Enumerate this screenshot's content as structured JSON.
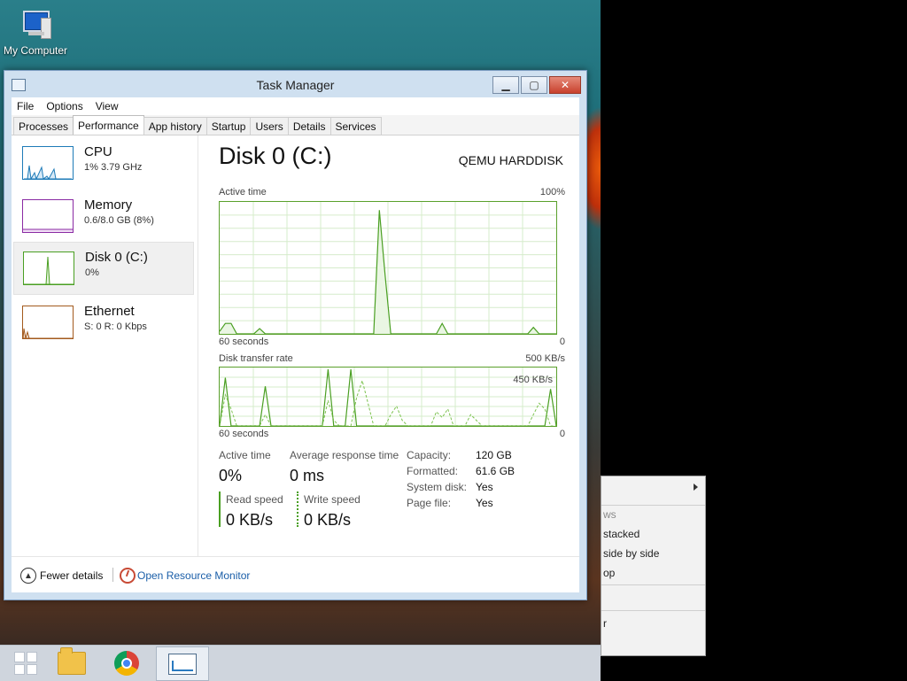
{
  "desktop": {
    "icons": [
      {
        "label": "My Computer",
        "icon": "computer-icon"
      }
    ]
  },
  "window": {
    "title": "Task Manager",
    "menu": [
      "File",
      "Options",
      "View"
    ],
    "tabs": [
      {
        "label": "Processes",
        "active": false
      },
      {
        "label": "Performance",
        "active": true
      },
      {
        "label": "App history",
        "active": false
      },
      {
        "label": "Startup",
        "active": false
      },
      {
        "label": "Users",
        "active": false
      },
      {
        "label": "Details",
        "active": false
      },
      {
        "label": "Services",
        "active": false
      }
    ]
  },
  "resources": [
    {
      "name": "CPU",
      "value": "1% 3.79 GHz",
      "color": "#1e7bb8"
    },
    {
      "name": "Memory",
      "value": "0.6/8.0 GB (8%)",
      "color": "#8a2aa3"
    },
    {
      "name": "Disk 0 (C:)",
      "value": "0%",
      "color": "#4a9f22",
      "selected": true
    },
    {
      "name": "Ethernet",
      "value": "S: 0 R: 0 Kbps",
      "color": "#a35a1d"
    }
  ],
  "detail": {
    "title": "Disk 0 (C:)",
    "model": "QEMU HARDDISK",
    "active_time_graph": {
      "label": "Active time",
      "max_label": "100%",
      "bottom_left": "60 seconds",
      "bottom_right": "0"
    },
    "transfer_graph": {
      "label": "Disk transfer rate",
      "max_label": "500 KB/s",
      "inner_label": "450 KB/s",
      "bottom_left": "60 seconds",
      "bottom_right": "0"
    },
    "stats": {
      "active_time_label": "Active time",
      "active_time_value": "0%",
      "response_label": "Average response time",
      "response_value": "0 ms",
      "read_label": "Read speed",
      "read_value": "0 KB/s",
      "write_label": "Write speed",
      "write_value": "0 KB/s"
    },
    "info": [
      {
        "label": "Capacity:",
        "value": "120 GB"
      },
      {
        "label": "Formatted:",
        "value": "61.6 GB"
      },
      {
        "label": "System disk:",
        "value": "Yes"
      },
      {
        "label": "Page file:",
        "value": "Yes"
      }
    ]
  },
  "footer": {
    "fewer_details": "Fewer details",
    "open_resource_monitor": "Open Resource Monitor"
  },
  "context_menu": {
    "items": [
      {
        "label": "ws",
        "muted": true
      },
      {
        "label": " stacked",
        "muted": false
      },
      {
        "label": " side by side",
        "muted": false
      },
      {
        "label": "op",
        "muted": false
      },
      {
        "label": "r",
        "muted": false
      }
    ]
  },
  "taskbar": {
    "items": [
      "start",
      "file-explorer",
      "chrome",
      "task-manager"
    ]
  },
  "series": {
    "active_time": [
      2,
      8,
      8,
      0,
      0,
      0,
      0,
      4,
      0,
      0,
      0,
      0,
      0,
      0,
      0,
      0,
      0,
      0,
      0,
      0,
      0,
      0,
      0,
      0,
      0,
      0,
      0,
      0,
      95,
      45,
      0,
      0,
      0,
      0,
      0,
      0,
      0,
      0,
      0,
      8,
      0,
      0,
      0,
      0,
      0,
      0,
      0,
      0,
      0,
      0,
      0,
      0,
      0,
      0,
      0,
      5,
      0,
      0,
      0,
      0
    ],
    "transfer_read": [
      0,
      85,
      0,
      0,
      0,
      0,
      0,
      0,
      70,
      0,
      0,
      0,
      0,
      0,
      0,
      0,
      0,
      0,
      0,
      100,
      0,
      0,
      0,
      100,
      0,
      0,
      0,
      0,
      0,
      0,
      0,
      0,
      0,
      0,
      0,
      0,
      0,
      0,
      0,
      0,
      0,
      0,
      0,
      0,
      0,
      0,
      0,
      0,
      0,
      0,
      0,
      0,
      0,
      0,
      0,
      0,
      0,
      0,
      65,
      0
    ],
    "transfer_write": [
      0,
      55,
      30,
      0,
      0,
      0,
      0,
      0,
      20,
      0,
      0,
      0,
      0,
      0,
      0,
      0,
      0,
      0,
      0,
      45,
      10,
      0,
      0,
      0,
      50,
      80,
      40,
      0,
      0,
      0,
      20,
      35,
      10,
      0,
      0,
      0,
      0,
      0,
      25,
      15,
      30,
      0,
      0,
      0,
      20,
      10,
      0,
      0,
      0,
      0,
      0,
      0,
      0,
      0,
      0,
      20,
      40,
      30,
      0,
      0
    ]
  }
}
